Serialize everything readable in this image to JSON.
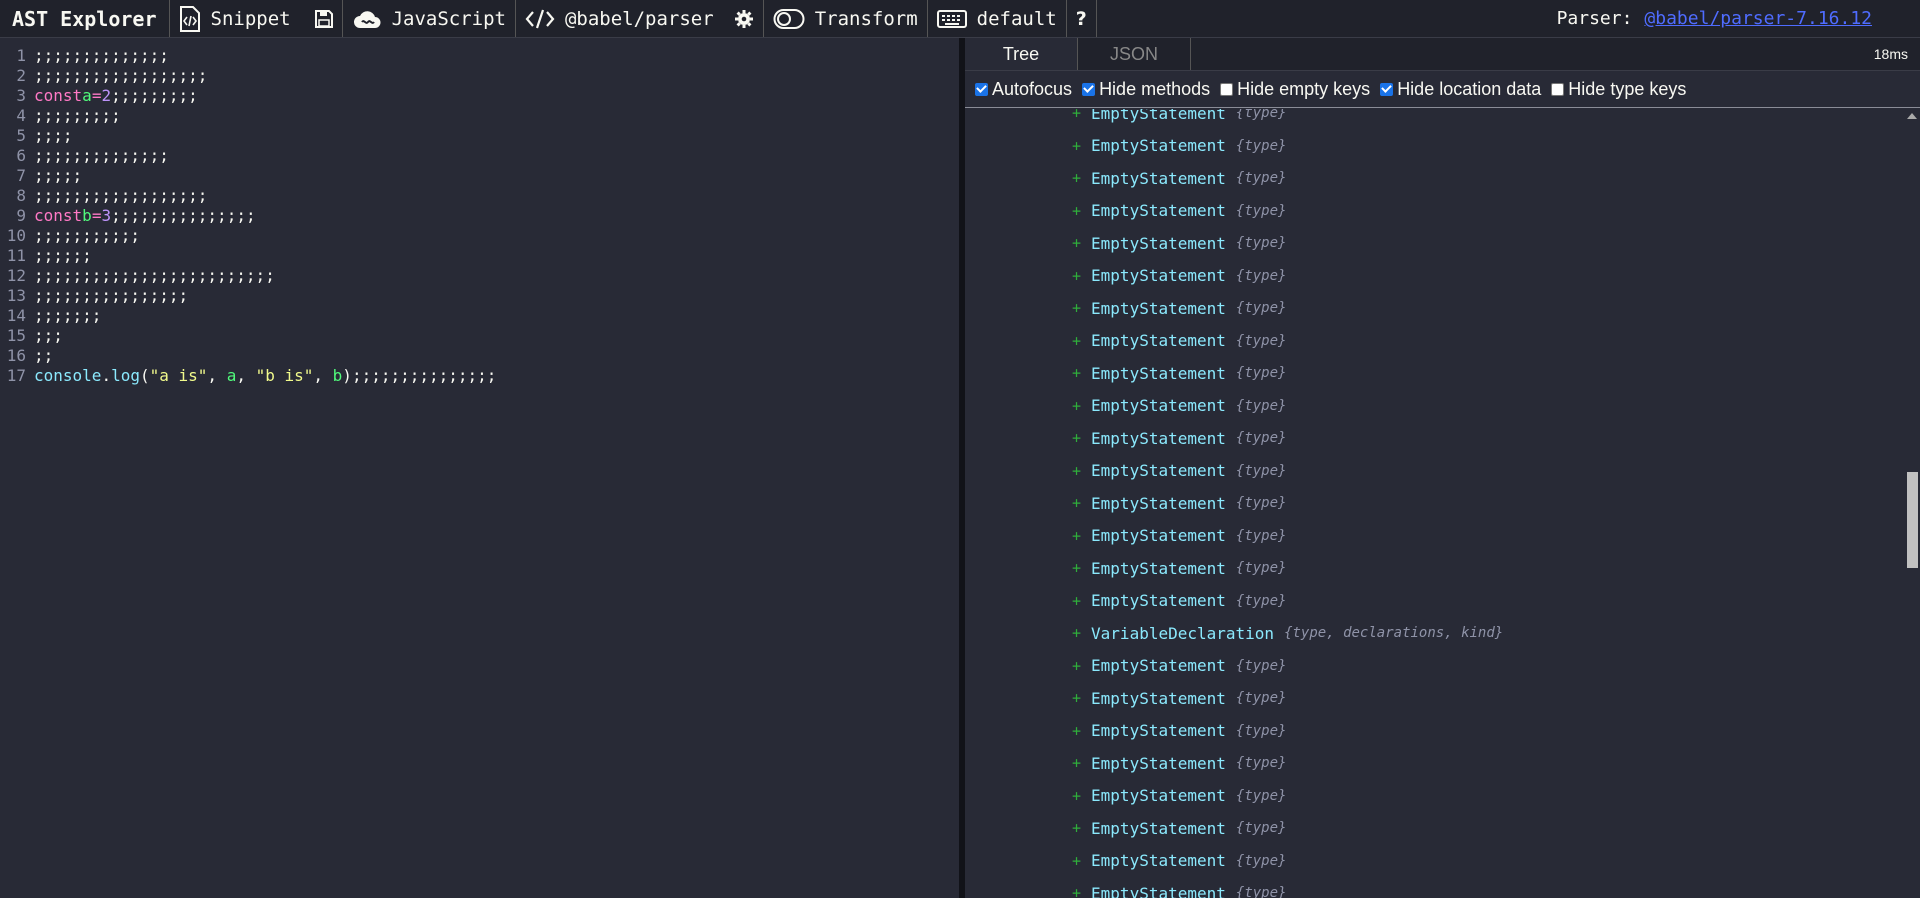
{
  "toolbar": {
    "title": "AST Explorer",
    "snippet_label": "Snippet",
    "language_label": "JavaScript",
    "parser_label": "@babel/parser",
    "transform_label": "Transform",
    "keymap_label": "default",
    "help_label": "?",
    "parser_info_prefix": "Parser:",
    "parser_version": "@babel/parser-7.16.12"
  },
  "editor": {
    "lines": [
      {
        "num": "1",
        "text": ";;;;;;;;;;;;;;"
      },
      {
        "num": "2",
        "text": ";;;;;;;;;;;;;;;;;;"
      },
      {
        "num": "3",
        "kw": "const",
        "var": "a",
        "op": "=",
        "num_val": "2",
        "rest": ";;;;;;;;;"
      },
      {
        "num": "4",
        "text": ";;;;;;;;;"
      },
      {
        "num": "5",
        "text": ";;;;"
      },
      {
        "num": "6",
        "text": ";;;;;;;;;;;;;;"
      },
      {
        "num": "7",
        "text": ";;;;;"
      },
      {
        "num": "8",
        "text": ";;;;;;;;;;;;;;;;;;"
      },
      {
        "num": "9",
        "kw": "const",
        "var": "b",
        "op": "=",
        "num_val": "3",
        "rest": ";;;;;;;;;;;;;;;"
      },
      {
        "num": "10",
        "text": ";;;;;;;;;;;"
      },
      {
        "num": "11",
        "text": ";;;;;;"
      },
      {
        "num": "12",
        "text": ";;;;;;;;;;;;;;;;;;;;;;;;;"
      },
      {
        "num": "13",
        "text": ";;;;;;;;;;;;;;;;"
      },
      {
        "num": "14",
        "text": ";;;;;;;"
      },
      {
        "num": "15",
        "text": ";;;"
      },
      {
        "num": "16",
        "text": ";;"
      },
      {
        "num": "17",
        "console": "console",
        "dot": ".",
        "fn": "log",
        "open": "(",
        "s1": "\"a is\"",
        "c1": ", ",
        "a1": "a",
        "c2": ", ",
        "s2": "\"b is\"",
        "c3": ", ",
        "a2": "b",
        "close": ")",
        "rest": ";;;;;;;;;;;;;;;"
      }
    ]
  },
  "pane": {
    "tabs": [
      "Tree",
      "JSON"
    ],
    "timing": "18ms",
    "options": [
      {
        "label": "Autofocus",
        "checked": true
      },
      {
        "label": "Hide methods",
        "checked": true
      },
      {
        "label": "Hide empty keys",
        "checked": false
      },
      {
        "label": "Hide location data",
        "checked": true
      },
      {
        "label": "Hide type keys",
        "checked": false
      }
    ],
    "nodes": [
      {
        "name": "EmptyStatement",
        "keys": "{type}"
      },
      {
        "name": "EmptyStatement",
        "keys": "{type}"
      },
      {
        "name": "EmptyStatement",
        "keys": "{type}"
      },
      {
        "name": "EmptyStatement",
        "keys": "{type}"
      },
      {
        "name": "EmptyStatement",
        "keys": "{type}"
      },
      {
        "name": "EmptyStatement",
        "keys": "{type}"
      },
      {
        "name": "EmptyStatement",
        "keys": "{type}"
      },
      {
        "name": "EmptyStatement",
        "keys": "{type}"
      },
      {
        "name": "EmptyStatement",
        "keys": "{type}"
      },
      {
        "name": "EmptyStatement",
        "keys": "{type}"
      },
      {
        "name": "EmptyStatement",
        "keys": "{type}"
      },
      {
        "name": "EmptyStatement",
        "keys": "{type}"
      },
      {
        "name": "EmptyStatement",
        "keys": "{type}"
      },
      {
        "name": "EmptyStatement",
        "keys": "{type}"
      },
      {
        "name": "EmptyStatement",
        "keys": "{type}"
      },
      {
        "name": "EmptyStatement",
        "keys": "{type}"
      },
      {
        "name": "VariableDeclaration",
        "keys": "{type, declarations, kind}"
      },
      {
        "name": "EmptyStatement",
        "keys": "{type}"
      },
      {
        "name": "EmptyStatement",
        "keys": "{type}"
      },
      {
        "name": "EmptyStatement",
        "keys": "{type}"
      },
      {
        "name": "EmptyStatement",
        "keys": "{type}"
      },
      {
        "name": "EmptyStatement",
        "keys": "{type}"
      },
      {
        "name": "EmptyStatement",
        "keys": "{type}"
      },
      {
        "name": "EmptyStatement",
        "keys": "{type}"
      },
      {
        "name": "EmptyStatement",
        "keys": "{type}"
      }
    ]
  }
}
